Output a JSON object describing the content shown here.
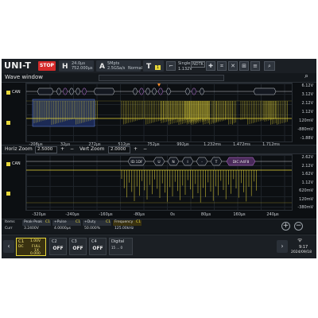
{
  "brand": "UNI-T",
  "run_state": "STOP",
  "horizontal": {
    "letter": "H",
    "scale": "24.0µs",
    "offset": "752.000µs"
  },
  "acquire": {
    "letter": "A",
    "rate": "5Mpts",
    "sample": "2.5GSa/s",
    "mode": "Normal"
  },
  "trigger": {
    "letter": "T",
    "channel_badge": "1",
    "mode": "Single",
    "level": "1.132V",
    "source_chip": "NDTK"
  },
  "wave_window": {
    "title": "Wave window"
  },
  "channel_name": "CAN",
  "colors": {
    "ch1": "#e8d83a",
    "decode_frame": "#c77ae0",
    "stop": "#d62a2a",
    "zoom_region": "#5a78c8"
  },
  "main": {
    "decode_frames": [
      "ID:1DF",
      "U",
      "N",
      "I",
      "-",
      "T",
      "ID:1DF"
    ],
    "right_labels": [
      "6.12V",
      "3.12V",
      "2.12V",
      "1.12V",
      "120mV",
      "-880mV",
      "-1.88V"
    ],
    "bottom_labels": [
      "-208µs",
      "32µs",
      "272µs",
      "512µs",
      "752µs",
      "992µs",
      "1.232ms",
      "1.472ms",
      "1.712ms"
    ]
  },
  "zoom_bar": {
    "horiz_label": "Horiz Zoom",
    "horiz_value": "2.5000",
    "vert_label": "Vert Zoom",
    "vert_value": "2.0000"
  },
  "zoom": {
    "decode_frames": [
      "ID:1DF",
      "U",
      "N",
      "I",
      "-",
      "T",
      "DIC:A4F8"
    ],
    "right_labels": [
      "2.62V",
      "2.12V",
      "1.62V",
      "1.12V",
      "620mV",
      "120mV",
      "-380mV"
    ],
    "bottom_labels": [
      "-320µs",
      "-240µs",
      "-160µs",
      "-80µs",
      "0s",
      "80µs",
      "160µs",
      "240µs"
    ]
  },
  "measurements": {
    "items_label": "Items",
    "curr_label": "Curr",
    "cells": [
      {
        "name": "Peak-Peak",
        "channel": "C1",
        "value": "3.2400V"
      },
      {
        "name": "+Pulse",
        "channel": "C1",
        "value": "4.0000µs"
      },
      {
        "name": "+Duty",
        "channel": "C1",
        "value": "50.000%"
      },
      {
        "name": "Frequency",
        "channel": "C1",
        "value": "125.00kHz"
      }
    ]
  },
  "channels": {
    "c1": {
      "name": "C1",
      "scale": "1.00V",
      "coupling": "DC",
      "bw": "FULL",
      "probe": "1X",
      "offset": "0.000"
    },
    "c2": {
      "name": "C2",
      "state": "OFF"
    },
    "c3": {
      "name": "C3",
      "state": "OFF"
    },
    "c4": {
      "name": "C4",
      "state": "OFF"
    },
    "digital": {
      "name": "Digital",
      "bits": "15 ... 0"
    }
  },
  "status": {
    "time": "9:17",
    "date": "2024/09/18"
  }
}
